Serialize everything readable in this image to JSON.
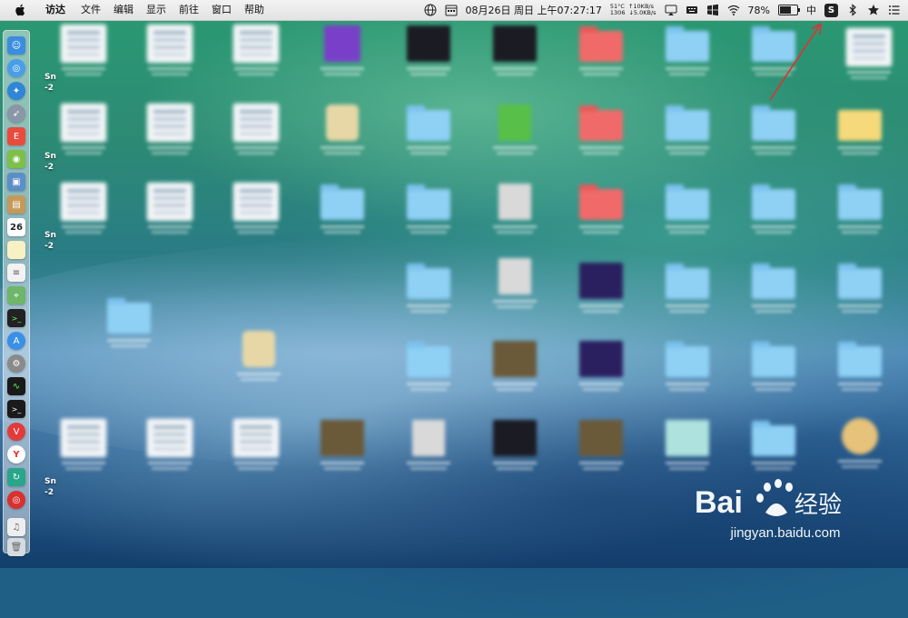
{
  "menubar": {
    "app_name": "访达",
    "items": [
      "文件",
      "编辑",
      "显示",
      "前往",
      "窗口",
      "帮助"
    ],
    "datetime": "08月26日 周日 上午07:27:17",
    "temp_line": "51°C",
    "fan_line": "1306",
    "upload": "↑10KB/s",
    "download": "↓5.0KB/s",
    "battery_percent": "78%",
    "battery_level": 0.78,
    "input_method": "中",
    "sogou_label": "S"
  },
  "desktop": {
    "left_labels": [
      "Sn",
      "-2",
      "Sn",
      "-2",
      "Sn",
      "-2",
      "Sn",
      "-2"
    ]
  },
  "dock": {
    "items": [
      "finder-icon",
      "safari-icon",
      "compass-icon",
      "launchpad-icon",
      "app-red-icon",
      "android-icon",
      "preview-icon",
      "notes-book-icon",
      "calendar-icon",
      "notes-icon",
      "textedit-icon",
      "maps-icon",
      "terminal-icon",
      "app-store-icon",
      "system-preferences-icon",
      "activity-monitor-icon",
      "terminal2-icon",
      "vivaldi-icon",
      "yandex-icon",
      "sync-icon",
      "netease-music-icon",
      "music-file-icon",
      "trash-icon"
    ],
    "calendar_day": "26"
  },
  "watermark": {
    "brand": "Bai 经验",
    "url": "jingyan.baidu.com"
  }
}
